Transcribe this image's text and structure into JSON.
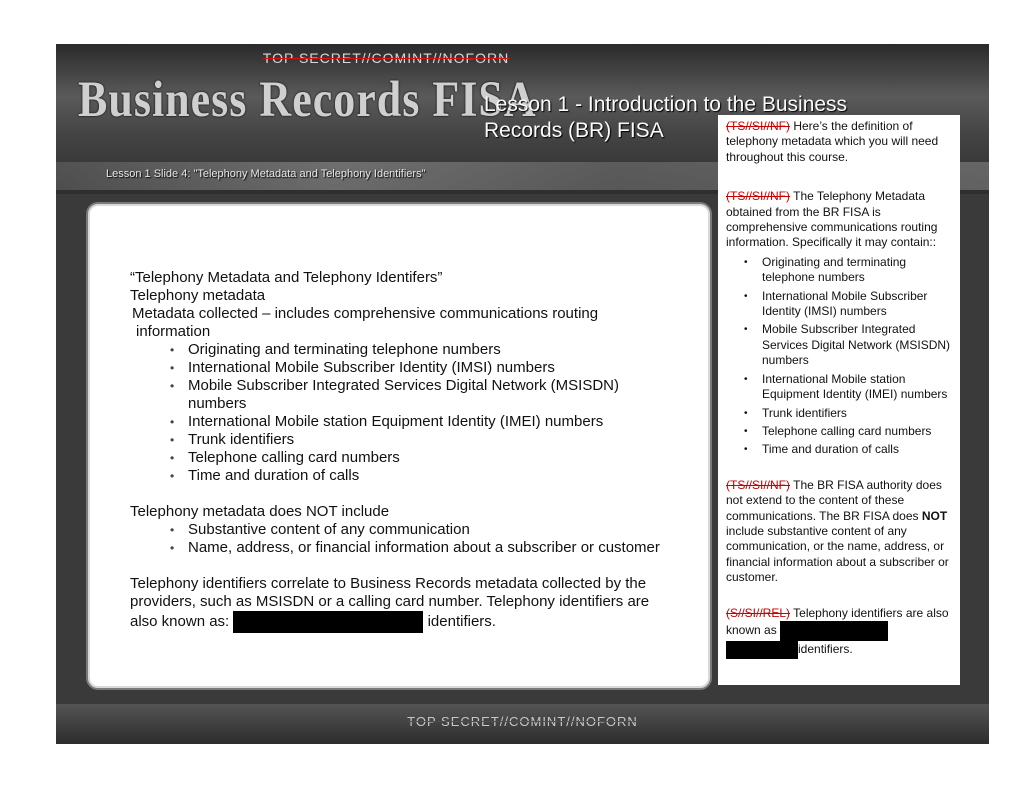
{
  "classification": {
    "top": "TOP SECRET//COMINT//NOFORN",
    "bottom": "TOP SECRET//COMINT//NOFORN"
  },
  "logo_text": "Business Records FISA",
  "lesson_title": "Lesson 1 - Introduction to the Business Records (BR) FISA",
  "breadcrumb": "Lesson 1 Slide 4: \"Telephony Metadata and Telephony Identifiers\"",
  "content": {
    "heading": "“Telephony Metadata and Telephony Identifers”",
    "sub_heading": "Telephony metadata",
    "collected_intro": "Metadata collected – includes comprehensive communications routing information",
    "collected_items": [
      "Originating and terminating telephone numbers",
      "International Mobile Subscriber Identity (IMSI) numbers",
      "Mobile Subscriber Integrated Services Digital Network (MSISDN) numbers",
      "International Mobile station Equipment Identity (IMEI) numbers",
      "Trunk identifiers",
      "Telephone calling card numbers",
      "Time and duration of calls"
    ],
    "not_include_heading": "Telephony metadata does NOT include",
    "not_include_items": [
      "Substantive content of any communication",
      "Name, address, or financial information about a subscriber or customer"
    ],
    "identifiers_text": "Telephony identifiers correlate to Business Records metadata collected by the providers, such as MSISDN or a calling card number.  Telephony identifiers are also known as:",
    "identifiers_suffix": "identifiers."
  },
  "notes": {
    "mark_ts": "(TS//SI//NF)",
    "mark_s": "(S//SI//REL)",
    "para1": "Here’s the definition of telephony metadata which you will need throughout this course.",
    "para2": "The Telephony Metadata obtained from the BR FISA is comprehensive communications routing information.  Specifically it may contain::",
    "items": [
      "Originating and terminating telephone numbers",
      "International Mobile Subscriber Identity (IMSI) numbers",
      "Mobile Subscriber Integrated Services Digital Network (MSISDN) numbers",
      "International Mobile station Equipment Identity (IMEI) numbers",
      "Trunk identifiers",
      "Telephone calling card numbers",
      "Time and duration of calls"
    ],
    "para3_pre": "The BR FISA authority does not extend to the content of these communications.  The BR FISA does ",
    "para3_bold": "NOT",
    "para3_post": " include substantive content of any communication, or the name, address, or financial information about a subscriber or customer.",
    "para4_pre": "Telephony identifiers are also known as",
    "para4_post": "identifiers."
  },
  "colors": {
    "classification_mark": "#cc0000",
    "redaction": "#000000"
  }
}
